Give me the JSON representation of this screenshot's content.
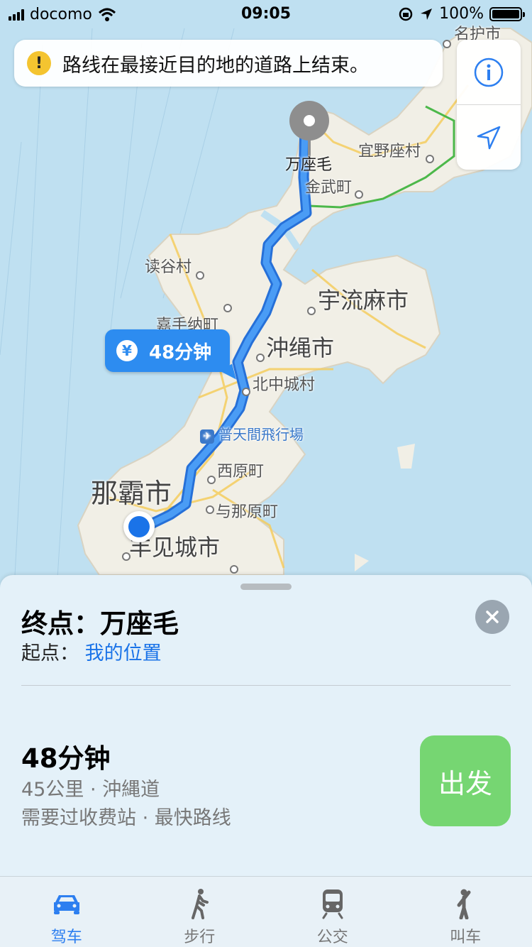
{
  "status_bar": {
    "carrier": "docomo",
    "time": "09:05",
    "battery": "100%",
    "battery_level": 1.0
  },
  "banner": {
    "message": "路线在最接近目的地的道路上结束。"
  },
  "map": {
    "labels": {
      "top_city": "名护市",
      "ginoza": "宜野座村",
      "kin": "金武町",
      "yomitan": "读谷村",
      "uruma": "宇流麻市",
      "kadena": "嘉手纳町",
      "okinawa": "沖绳市",
      "kitanakagusuku": "北中城村",
      "airport": "普天間飛行場",
      "nishihara": "西原町",
      "naha": "那霸市",
      "yonabaru": "与那原町",
      "tomigusuku": "丰见城市",
      "destination_pin": "万座毛"
    },
    "route_bubble": {
      "currency_icon": "¥",
      "duration": "48分钟"
    }
  },
  "sheet": {
    "destination": "终点：万座毛",
    "origin_prefix": "起点：",
    "origin_value": "我的位置",
    "duration": "48分钟",
    "distance": "45公里 · 沖縄道",
    "note": "需要过收费站 · 最快路线",
    "go_label": "出发"
  },
  "tabs": [
    {
      "label": "驾车",
      "icon": "car-icon",
      "active": true
    },
    {
      "label": "步行",
      "icon": "walk-icon",
      "active": false
    },
    {
      "label": "公交",
      "icon": "transit-icon",
      "active": false
    },
    {
      "label": "叫车",
      "icon": "ride-icon",
      "active": false
    }
  ],
  "colors": {
    "route": "#3b8df0",
    "accent": "#2d7ff0",
    "go_button": "#76d672",
    "land": "#f1efe6",
    "water": "#bfe0f1"
  }
}
